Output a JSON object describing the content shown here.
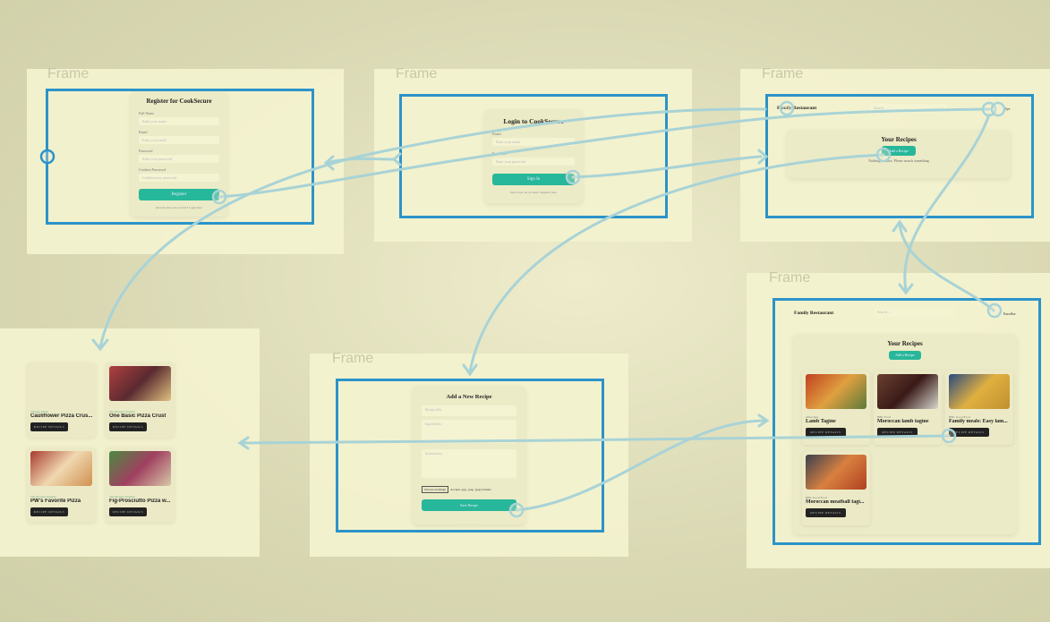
{
  "frame_label": "Frame",
  "register": {
    "title": "Register for CookSecure",
    "fields": [
      {
        "label": "Full Name",
        "placeholder": "Enter your name"
      },
      {
        "label": "Email",
        "placeholder": "Enter your email"
      },
      {
        "label": "Password",
        "placeholder": "Enter your password"
      },
      {
        "label": "Confirm Password",
        "placeholder": "Confirm your password"
      }
    ],
    "button": "Register",
    "footer": "Already have an account? Login here"
  },
  "login": {
    "title": "Login to CookSecure",
    "fields": [
      {
        "label": "Email",
        "placeholder": "Enter your email"
      },
      {
        "label": "Password",
        "placeholder": "Enter your password"
      }
    ],
    "button": "Sign In",
    "footer": "Don't have an account? Register here"
  },
  "home_empty": {
    "brand": "Family Restaurant",
    "search_placeholder": "Search...",
    "user": "Bye",
    "heading": "Your Recipes",
    "add_button": "Add a Recipe",
    "empty_text": "Nothing to show. Please search something"
  },
  "search_results": {
    "cards": [
      {
        "source": "Vintage Mixer",
        "title": "Cauliflower Pizza Crus...",
        "button": "RECIPE DETAILS"
      },
      {
        "source": "The Pioneer Woman",
        "title": "One Basic Pizza Crust",
        "button": "RECIPE DETAILS"
      },
      {
        "source": "The Pioneer Woman",
        "title": "PW's Favorite Pizza",
        "button": "RECIPE DETAILS"
      },
      {
        "source": "The Pioneer Woman",
        "title": "Fig-Prosciutto Pizza w...",
        "button": "RECIPE DETAILS"
      }
    ]
  },
  "add_recipe": {
    "title": "Add a New Recipe",
    "name_placeholder": "Recipe title",
    "ingredients_placeholder": "Ingredients",
    "instructions_placeholder": "Instructions",
    "file_button": "Choose an image",
    "file_text": "Accepts .jpg, .png, .jpeg formats",
    "button": "Save Recipe"
  },
  "home_full": {
    "brand": "Family Restaurant",
    "search_placeholder": "Search...",
    "user": "Enrollee",
    "heading": "Your Recipes",
    "add_button": "Add a Recipe",
    "cards": [
      {
        "source": "Allrecipes",
        "title": "Lamb Tagine",
        "button": "RECIPE DETAILS"
      },
      {
        "source": "BBC Food",
        "title": "Moroccan lamb tagine",
        "button": "RECIPE DETAILS"
      },
      {
        "source": "BBC Good Food",
        "title": "Family meals: Easy lam...",
        "button": "RECIPE DETAILS"
      },
      {
        "source": "BBC Good Food",
        "title": "Moroccan meatball tagi...",
        "button": "RECIPE DETAILS"
      }
    ]
  },
  "colors": {
    "frame_border": "#2b93c9",
    "connector": "#a8d3d6",
    "accent": "#27b79a"
  }
}
